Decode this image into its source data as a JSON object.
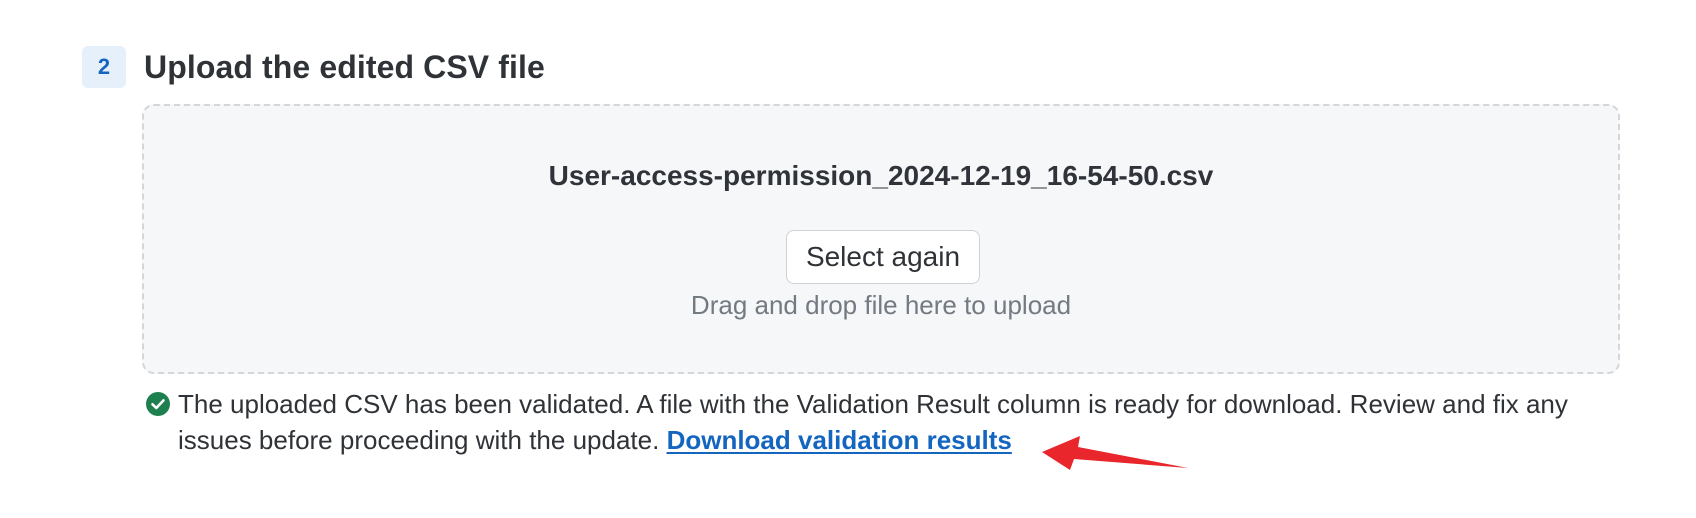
{
  "step": {
    "number": "2",
    "title": "Upload the edited CSV file"
  },
  "dropzone": {
    "file_name": "User-access-permission_2024-12-19_16-54-50.csv",
    "select_again_label": "Select again",
    "hint": "Drag and drop file here to upload"
  },
  "validation": {
    "icon": "check-circle-icon",
    "message": "The uploaded CSV has been validated. A file with the Validation Result column is ready for download. Review and fix any issues before proceeding with the update.",
    "link_label": "Download validation results"
  },
  "annotation": {
    "icon": "red-arrow",
    "color": "#e8262b"
  },
  "colors": {
    "accent": "#1465c0",
    "success": "#1e7f4f",
    "badge_bg": "#e6f0fb"
  }
}
